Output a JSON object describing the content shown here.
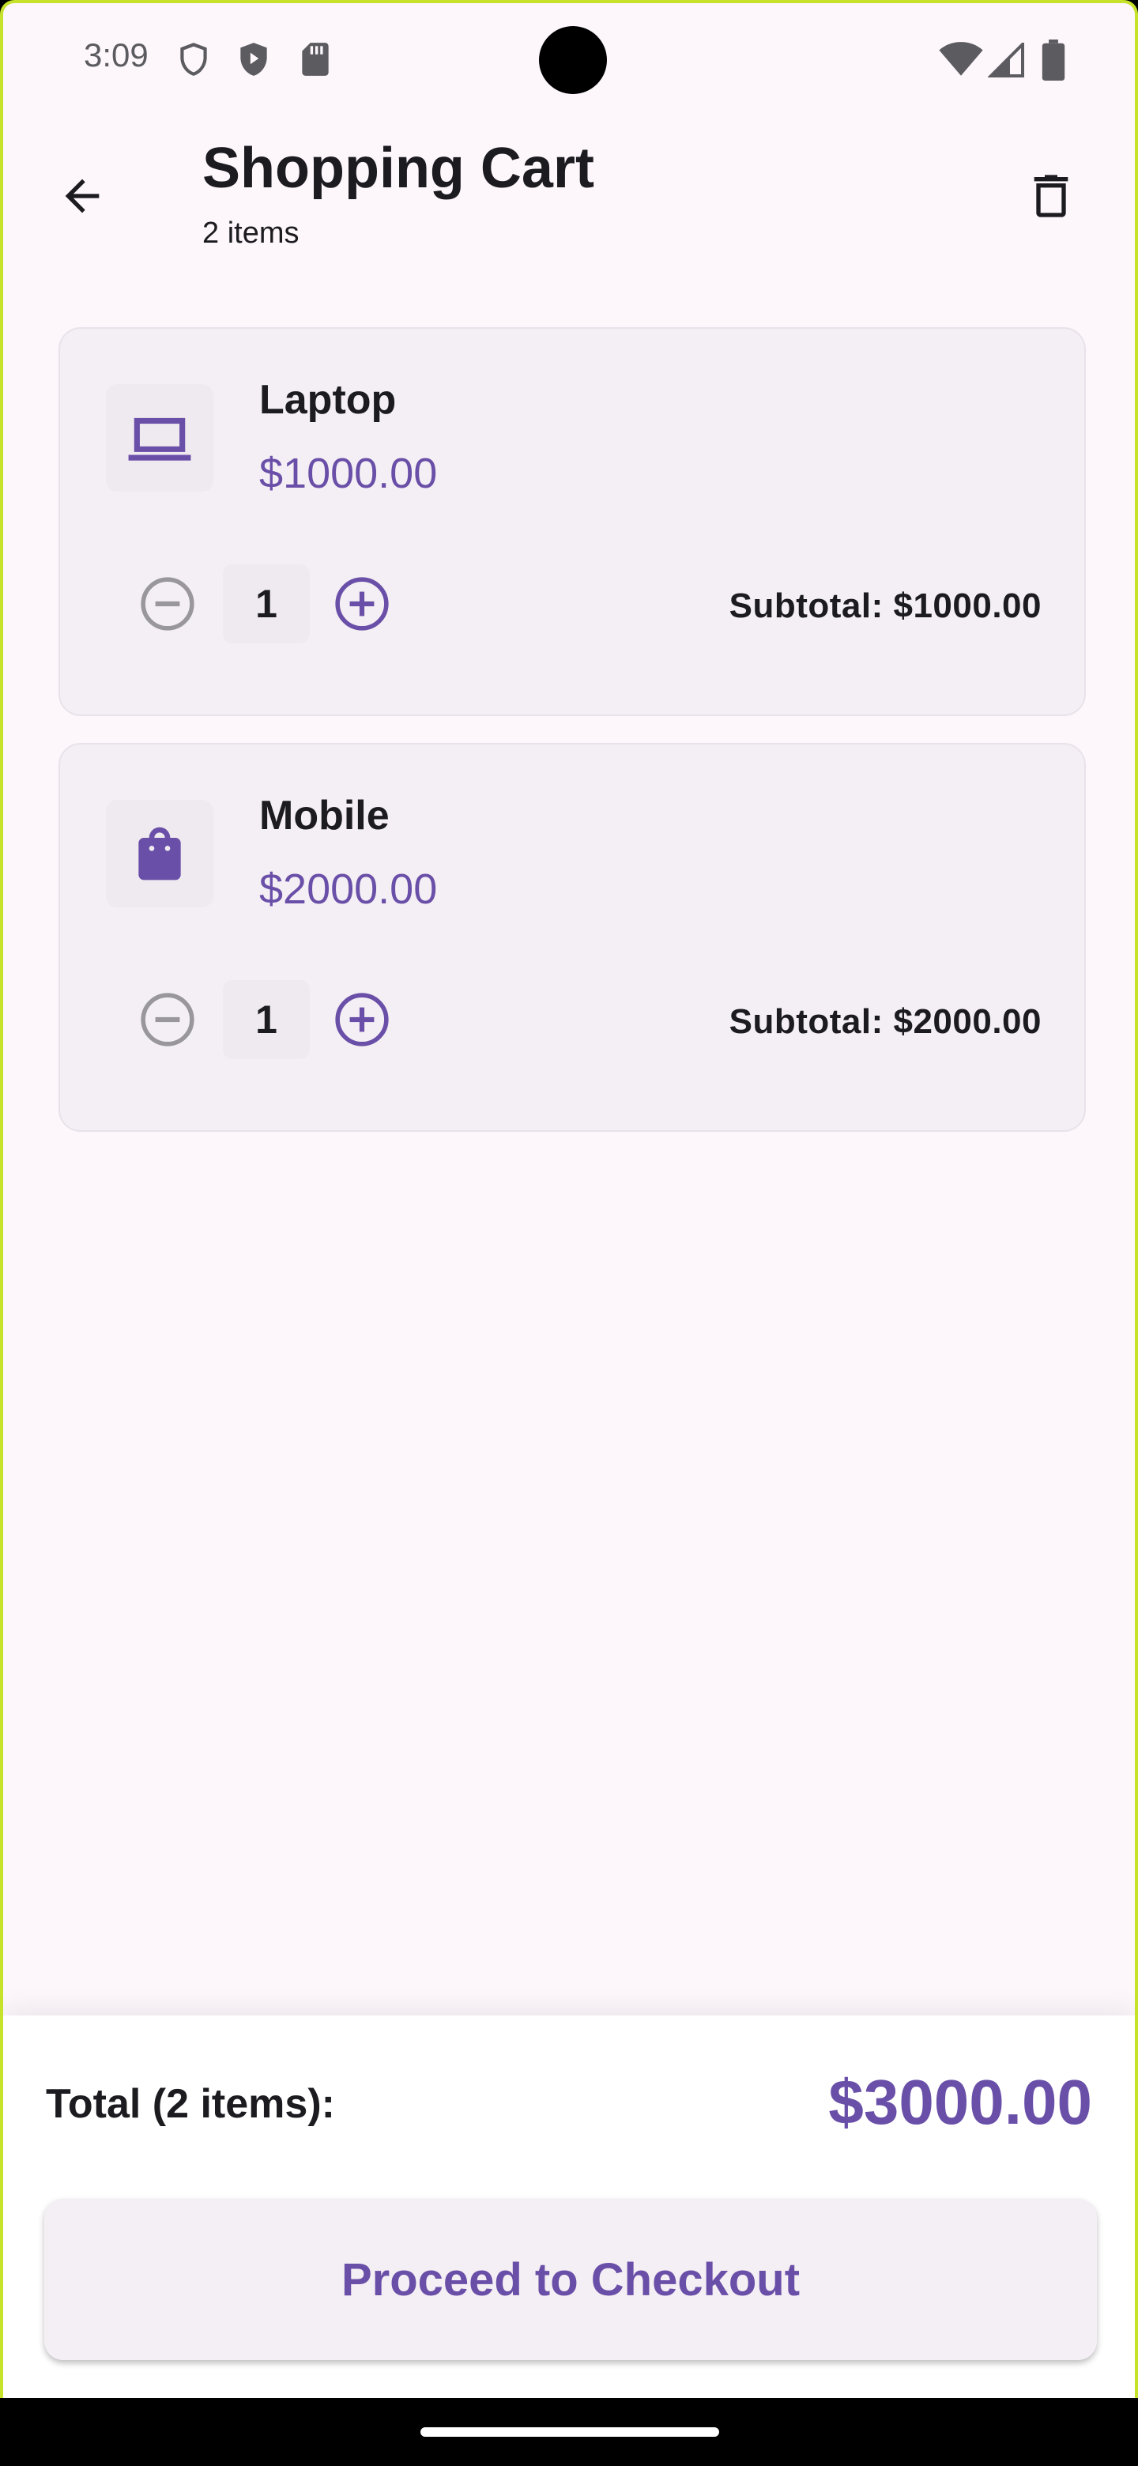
{
  "status": {
    "time": "3:09"
  },
  "appbar": {
    "title": "Shopping Cart",
    "subtitle": "2 items"
  },
  "items": [
    {
      "name": "Laptop",
      "price": "$1000.00",
      "quantity": "1",
      "subtotal": "Subtotal: $1000.00",
      "icon": "laptop-icon"
    },
    {
      "name": "Mobile",
      "price": "$2000.00",
      "quantity": "1",
      "subtotal": "Subtotal: $2000.00",
      "icon": "shopping-bag-icon"
    }
  ],
  "summary": {
    "total_label": "Total (2 items):",
    "total_value": "$3000.00",
    "checkout_label": "Proceed to Checkout"
  },
  "colors": {
    "accent": "#6a4fa8",
    "background": "#fdf7fc",
    "card": "#f4eff4",
    "text": "#1c1b20"
  }
}
